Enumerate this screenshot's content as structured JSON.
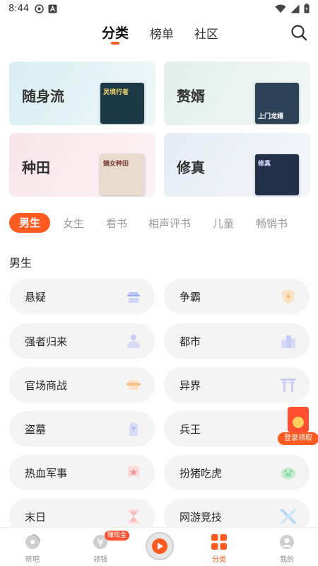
{
  "status": {
    "time": "8:44"
  },
  "top_tabs": {
    "items": [
      "分类",
      "榜单",
      "社区"
    ],
    "active": "分类"
  },
  "featured": [
    {
      "label": "随身流",
      "book_title": "灵境行者",
      "bg": "#d9eef2",
      "book_color": "#1c3a46"
    },
    {
      "label": "赘婿",
      "book_title": "上门龙婿",
      "bg": "#e3efeb",
      "book_color": "#2c4256"
    },
    {
      "label": "种田",
      "book_title": "嫡女种田",
      "bg": "#f8e5e9",
      "book_color": "#e9dccf"
    },
    {
      "label": "修真",
      "book_title": "修真",
      "bg": "#e6ecf4",
      "book_color": "#23304a"
    }
  ],
  "sub_tabs": {
    "items": [
      "男生",
      "女生",
      "看书",
      "相声评书",
      "儿童",
      "畅销书"
    ],
    "active": "男生"
  },
  "section_title": "男生",
  "genres": [
    {
      "label": "悬疑",
      "icon": "detective-icon"
    },
    {
      "label": "争霸",
      "icon": "shield-icon"
    },
    {
      "label": "强者归来",
      "icon": "person-icon"
    },
    {
      "label": "都市",
      "icon": "city-icon"
    },
    {
      "label": "官场商战",
      "icon": "scroll-icon"
    },
    {
      "label": "异界",
      "icon": "torii-gate-icon"
    },
    {
      "label": "盗墓",
      "icon": "tombstone-icon"
    },
    {
      "label": "兵王",
      "icon": "medal-icon"
    },
    {
      "label": "热血军事",
      "icon": "banner-star-icon"
    },
    {
      "label": "扮猪吃虎",
      "icon": "pig-icon"
    },
    {
      "label": "末日",
      "icon": "hourglass-icon"
    },
    {
      "label": "网游竞技",
      "icon": "crossed-swords-icon"
    }
  ],
  "red_packet": {
    "label": "登录领取"
  },
  "bottom_nav": {
    "items": [
      "听吧",
      "领钱",
      "",
      "分类",
      "我的"
    ],
    "active": "分类",
    "badge": "赚现金"
  },
  "colors": {
    "accent": "#ff5a1f",
    "pill_bg": "#f4f4f4",
    "icon_tint": "#c8cdf5"
  }
}
